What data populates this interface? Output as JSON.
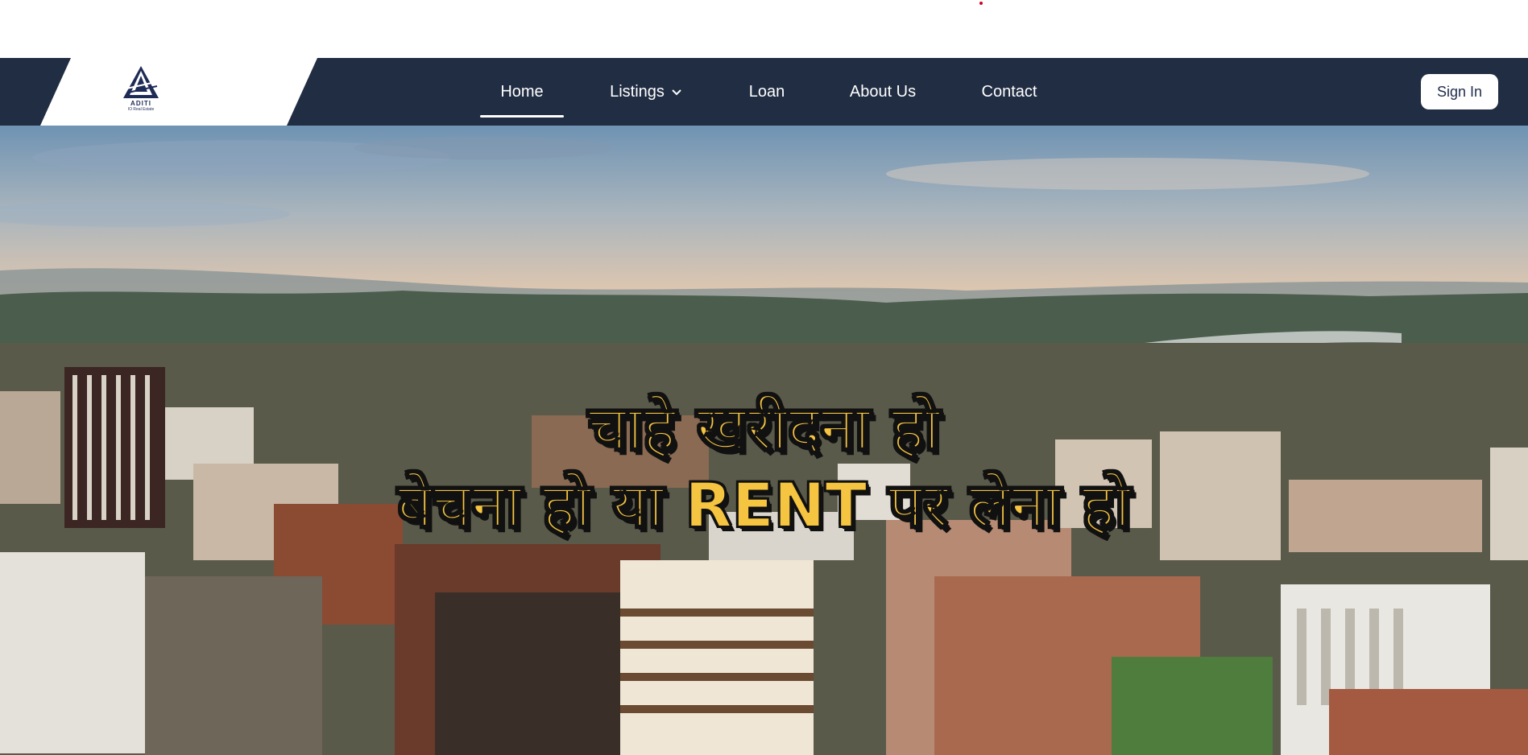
{
  "topbar": {},
  "logo": {
    "name": "ADITI",
    "tagline": "IO Real Estate"
  },
  "nav": {
    "items": [
      {
        "label": "Home",
        "active": true
      },
      {
        "label": "Listings",
        "has_dropdown": true
      },
      {
        "label": "Loan"
      },
      {
        "label": "About Us"
      },
      {
        "label": "Contact"
      }
    ],
    "sign_in": "Sign In"
  },
  "hero": {
    "line1": "चाहे खरीदना हो",
    "line2": "बेचना हो या RENT पर लेना हो",
    "background": "aerial city skyline at sunset"
  },
  "colors": {
    "navbar": "#212d42",
    "headline": "#f5c440",
    "topbar_dot": "#d0021b"
  }
}
